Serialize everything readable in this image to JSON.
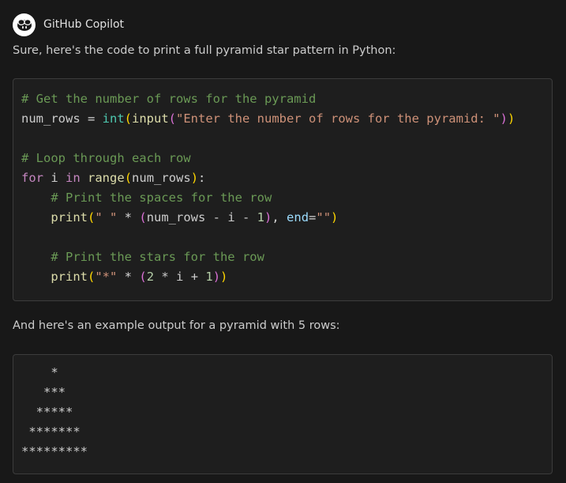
{
  "header": {
    "title": "GitHub Copilot",
    "avatar_icon": "copilot-icon"
  },
  "intro_text": "Sure, here's the code to print a full pyramid star pattern in Python:",
  "code": {
    "language": "python",
    "lines": [
      [
        {
          "text": "# Get the number of rows for the pyramid",
          "cls": "cm"
        }
      ],
      [
        {
          "text": "num_rows",
          "cls": "vr"
        },
        {
          "text": " = ",
          "cls": "op"
        },
        {
          "text": "int",
          "cls": "bi"
        },
        {
          "text": "(",
          "cls": "p1"
        },
        {
          "text": "input",
          "cls": "fn"
        },
        {
          "text": "(",
          "cls": "p2"
        },
        {
          "text": "\"Enter the number of rows for the pyramid: \"",
          "cls": "st"
        },
        {
          "text": ")",
          "cls": "p2"
        },
        {
          "text": ")",
          "cls": "p1"
        }
      ],
      [],
      [
        {
          "text": "# Loop through each row",
          "cls": "cm"
        }
      ],
      [
        {
          "text": "for",
          "cls": "kw"
        },
        {
          "text": " i ",
          "cls": "vr"
        },
        {
          "text": "in",
          "cls": "kw"
        },
        {
          "text": " ",
          "cls": "vr"
        },
        {
          "text": "range",
          "cls": "fn"
        },
        {
          "text": "(",
          "cls": "p1"
        },
        {
          "text": "num_rows",
          "cls": "vr"
        },
        {
          "text": ")",
          "cls": "p1"
        },
        {
          "text": ":",
          "cls": "op"
        }
      ],
      [
        {
          "text": "    ",
          "cls": "vr"
        },
        {
          "text": "# Print the spaces for the row",
          "cls": "cm"
        }
      ],
      [
        {
          "text": "    ",
          "cls": "vr"
        },
        {
          "text": "print",
          "cls": "fn"
        },
        {
          "text": "(",
          "cls": "p1"
        },
        {
          "text": "\" \"",
          "cls": "st"
        },
        {
          "text": " * ",
          "cls": "op"
        },
        {
          "text": "(",
          "cls": "p2"
        },
        {
          "text": "num_rows - i - ",
          "cls": "vr"
        },
        {
          "text": "1",
          "cls": "nm"
        },
        {
          "text": ")",
          "cls": "p2"
        },
        {
          "text": ", ",
          "cls": "op"
        },
        {
          "text": "end",
          "cls": "pm"
        },
        {
          "text": "=",
          "cls": "op"
        },
        {
          "text": "\"\"",
          "cls": "st"
        },
        {
          "text": ")",
          "cls": "p1"
        }
      ],
      [],
      [
        {
          "text": "    ",
          "cls": "vr"
        },
        {
          "text": "# Print the stars for the row",
          "cls": "cm"
        }
      ],
      [
        {
          "text": "    ",
          "cls": "vr"
        },
        {
          "text": "print",
          "cls": "fn"
        },
        {
          "text": "(",
          "cls": "p1"
        },
        {
          "text": "\"*\"",
          "cls": "st"
        },
        {
          "text": " * ",
          "cls": "op"
        },
        {
          "text": "(",
          "cls": "p2"
        },
        {
          "text": "2",
          "cls": "nm"
        },
        {
          "text": " * i + ",
          "cls": "vr"
        },
        {
          "text": "1",
          "cls": "nm"
        },
        {
          "text": ")",
          "cls": "p2"
        },
        {
          "text": ")",
          "cls": "p1"
        }
      ]
    ]
  },
  "example_text": "And here's an example output for a pyramid with 5 rows:",
  "output": {
    "lines": [
      "    *",
      "   ***",
      "  *****",
      " *******",
      "*********"
    ]
  }
}
